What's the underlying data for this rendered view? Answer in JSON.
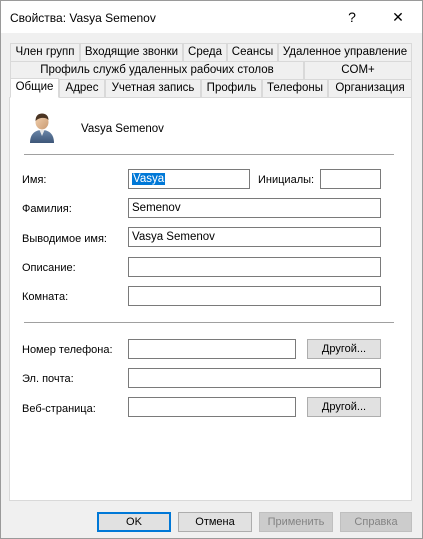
{
  "window": {
    "title": "Свойства: Vasya Semenov",
    "help_glyph": "?",
    "close_glyph": "✕"
  },
  "tabs": {
    "row1": [
      "Член групп",
      "Входящие звонки",
      "Среда",
      "Сеансы",
      "Удаленное управление"
    ],
    "row2": [
      "Профиль служб удаленных рабочих столов",
      "COM+"
    ],
    "row3": [
      "Общие",
      "Адрес",
      "Учетная запись",
      "Профиль",
      "Телефоны",
      "Организация"
    ],
    "active": "Общие"
  },
  "general": {
    "display_name": "Vasya Semenov",
    "first_name_label": "Имя:",
    "first_name_value": "Vasya",
    "initials_label": "Инициалы:",
    "initials_value": "",
    "last_name_label": "Фамилия:",
    "last_name_value": "Semenov",
    "display_name_label": "Выводимое имя:",
    "display_name_value": "Vasya Semenov",
    "description_label": "Описание:",
    "description_value": "",
    "office_label": "Комната:",
    "office_value": "",
    "phone_label": "Номер телефона:",
    "phone_value": "",
    "phone_other_label": "Другой...",
    "email_label": "Эл. почта:",
    "email_value": "",
    "web_label": "Веб-страница:",
    "web_value": "",
    "web_other_label": "Другой..."
  },
  "footer": {
    "ok_label": "OK",
    "cancel_label": "Отмена",
    "apply_label": "Применить",
    "help_label": "Справка"
  },
  "colors": {
    "selection": "#0078d7",
    "dialog_bg": "#f0f0f0"
  }
}
